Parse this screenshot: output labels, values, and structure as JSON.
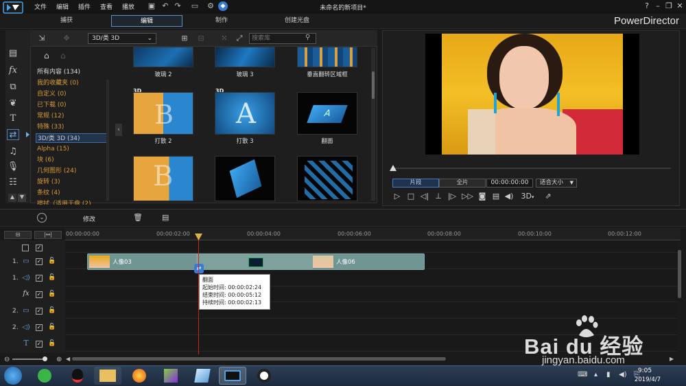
{
  "menu": [
    "文件",
    "编辑",
    "插件",
    "查看",
    "播放"
  ],
  "window_title": "未命名的新项目*",
  "brand": "PowerDirector",
  "modes": [
    "捕获",
    "编辑",
    "制作",
    "创建光盘"
  ],
  "library": {
    "category_select": "3D/类 3D",
    "search_placeholder": "搜索库",
    "categories": [
      "所有内容 (134)",
      "我的收藏夹 (0)",
      "自定义 (0)",
      "已下载 (0)",
      "常规 (12)",
      "特殊 (33)",
      "3D/类 3D (34)",
      "Alpha (15)",
      "块 (6)",
      "几何图形 (24)",
      "旋转 (3)",
      "条纹 (4)",
      "擦拭（适用于盘 (2)"
    ],
    "top_row_labels": [
      "玻璃 2",
      "玻璃 3",
      "垂直翻转区域框"
    ],
    "middle_row_labels": [
      "打散 2",
      "打散 3",
      "翻面"
    ],
    "badge_3d": "3D"
  },
  "preview": {
    "clip_btn": "片段",
    "full_btn": "全片",
    "timecode": "00:00:00:00",
    "fit": "适合大小",
    "mode_3d": "3D"
  },
  "edit_toolbar": {
    "modify": "修改"
  },
  "timeline": {
    "ruler": [
      "00:00:00:00",
      "00:00:02:00",
      "00:00:04:00",
      "00:00:06:00",
      "00:00:08:00",
      "00:00:10:00",
      "00:00:12:00"
    ],
    "track_numbers": [
      "1.",
      "1.",
      "",
      "2.",
      "2.",
      ""
    ],
    "clip_a": "人像03",
    "clip_b": "人像06",
    "tooltip": {
      "name": "翻面",
      "start": "起始时间: 00:00:02:24",
      "end": "结束时间: 00:00:05:12",
      "duration": "持续时间: 00:00:02:13"
    }
  },
  "taskbar": {
    "time": "9:05",
    "date": "2019/4/7"
  },
  "watermark": {
    "text": "Bai du 经验",
    "url": "jingyan.baidu.com"
  }
}
